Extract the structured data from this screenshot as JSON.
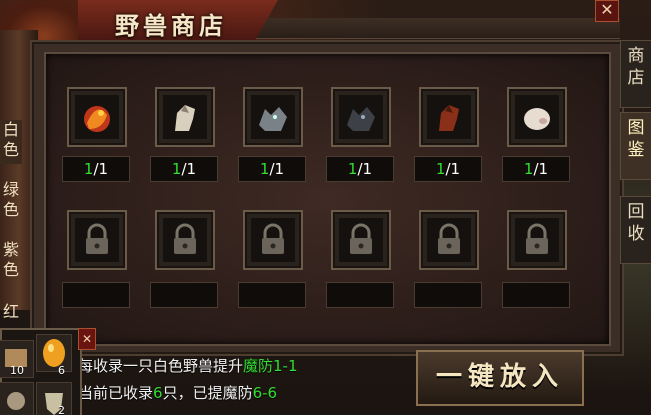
{
  "window": {
    "title": "野兽商店",
    "close_label": "✕"
  },
  "side_tabs": [
    {
      "label": "商店",
      "active": false
    },
    {
      "label": "图鉴",
      "active": true
    },
    {
      "label": "回收",
      "active": false
    }
  ],
  "left_tabs": [
    "白色",
    "绿色",
    "紫色",
    "红"
  ],
  "beasts": [
    {
      "icon": "fire-beast-icon",
      "collected": "1",
      "total": "/1"
    },
    {
      "icon": "white-horse-icon",
      "collected": "1",
      "total": "/1"
    },
    {
      "icon": "grey-wolf-icon",
      "collected": "1",
      "total": "/1"
    },
    {
      "icon": "dark-wolf-icon",
      "collected": "1",
      "total": "/1"
    },
    {
      "icon": "red-horse-icon",
      "collected": "1",
      "total": "/1"
    },
    {
      "icon": "white-pig-icon",
      "collected": "1",
      "total": "/1"
    }
  ],
  "locked_slots": 6,
  "info": {
    "line1_prefix": "每收录一只白色野兽提升",
    "line1_value": "魔防1-1",
    "line2_prefix": "当前已收录",
    "line2_count": "6",
    "line2_mid": "只，已提魔防",
    "line2_value": "6-6"
  },
  "button": {
    "label": "一键放入"
  },
  "bag": {
    "close_label": "✕",
    "items": [
      {
        "icon": "scroll-icon",
        "count": "10"
      },
      {
        "icon": "gold-egg-icon",
        "count": "6"
      },
      {
        "icon": "orb-icon",
        "count": ""
      },
      {
        "icon": "shield-item-icon",
        "count": "2"
      }
    ]
  },
  "colors": {
    "accent_green": "#33dd33",
    "title_red": "#7a2c1c"
  }
}
